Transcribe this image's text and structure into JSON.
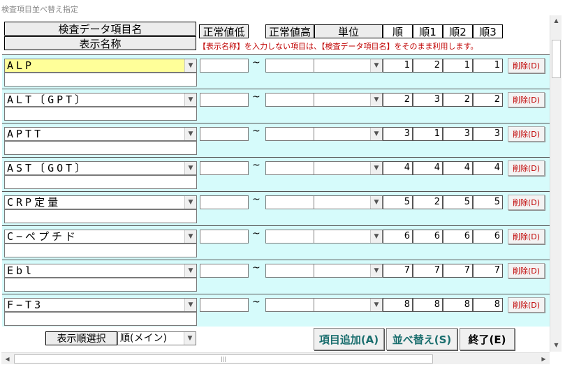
{
  "window": {
    "title": "検査項目並べ替え指定"
  },
  "header": {
    "item_name": "検査データ項目名",
    "display_name": "表示名称",
    "normal_low": "正常値低",
    "normal_high": "正常値高",
    "unit": "単位",
    "order": "順",
    "order1": "順1",
    "order2": "順2",
    "order3": "順3",
    "note": "【表示名称】を入力しない項目は、【検査データ項目名】をそのまま利用します。"
  },
  "range_separator": "~",
  "delete_label": "削除(D)",
  "rows": [
    {
      "name": "ALP",
      "order": "1",
      "order1": "2",
      "order2": "1",
      "order3": "1",
      "highlighted": true
    },
    {
      "name": "ALT〔GPT〕",
      "order": "2",
      "order1": "3",
      "order2": "2",
      "order3": "2"
    },
    {
      "name": "APTT",
      "order": "3",
      "order1": "1",
      "order2": "3",
      "order3": "3"
    },
    {
      "name": "AST〔GOT〕",
      "order": "4",
      "order1": "4",
      "order2": "4",
      "order3": "4"
    },
    {
      "name": "CRP定量",
      "order": "5",
      "order1": "2",
      "order2": "5",
      "order3": "5"
    },
    {
      "name": "C−ペプチド",
      "order": "6",
      "order1": "6",
      "order2": "6",
      "order3": "6"
    },
    {
      "name": "Ebl",
      "order": "7",
      "order1": "7",
      "order2": "7",
      "order3": "7"
    },
    {
      "name": "F−T3",
      "order": "8",
      "order1": "8",
      "order2": "8",
      "order3": "8"
    }
  ],
  "footer": {
    "sort_select_label": "表示順選択",
    "sort_select_value": "順(メイン)",
    "add_button": "項目追加(A)",
    "sort_button": "並べ替え(S)",
    "exit_button": "終了(E)"
  },
  "colors": {
    "row_bg": "#d6fbfb",
    "highlight": "#ffff99",
    "accent_text": "#1a6e6e",
    "note_text": "#c00000"
  }
}
